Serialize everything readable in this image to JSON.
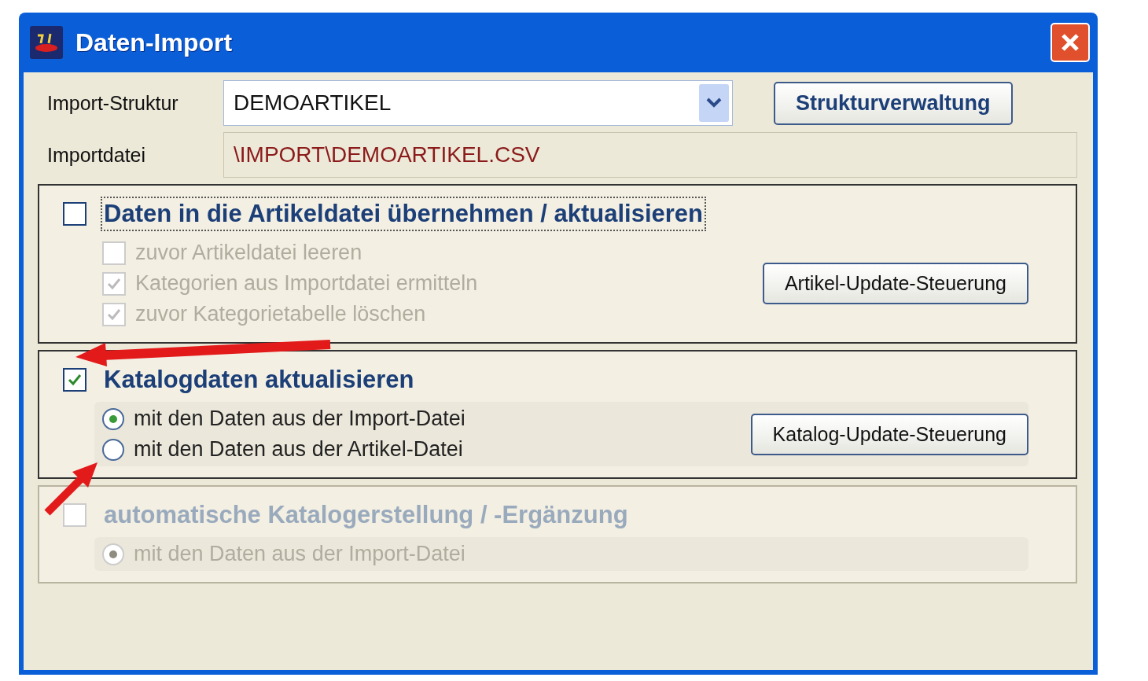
{
  "window": {
    "title": "Daten-Import"
  },
  "fields": [
    {
      "label": "Import-Struktur",
      "kind": "dropdown",
      "value": "DEMOARTIKEL"
    },
    {
      "label": "Importdatei",
      "kind": "readonly",
      "value": "\\IMPORT\\DEMOARTIKEL.CSV"
    }
  ],
  "structure_button": "Strukturverwaltung",
  "groups": [
    {
      "title": "Daten in die Artikeldatei übernehmen / aktualisieren",
      "checked": false,
      "focused": true,
      "disabled": false,
      "button": "Artikel-Update-Steuerung",
      "options": [
        {
          "kind": "checkbox",
          "label": "zuvor Artikeldatei leeren",
          "checked": false,
          "disabled": true
        },
        {
          "kind": "checkbox",
          "label": "Kategorien aus Importdatei ermitteln",
          "checked": true,
          "disabled": true
        },
        {
          "kind": "checkbox",
          "label": "zuvor Kategorietabelle löschen",
          "checked": true,
          "disabled": true
        }
      ]
    },
    {
      "title": "Katalogdaten aktualisieren",
      "checked": true,
      "focused": false,
      "disabled": false,
      "button": "Katalog-Update-Steuerung",
      "options": [
        {
          "kind": "radio",
          "label": "mit den Daten aus der Import-Datei",
          "selected": true,
          "disabled": false
        },
        {
          "kind": "radio",
          "label": "mit den Daten aus der Artikel-Datei",
          "selected": false,
          "disabled": false
        }
      ]
    },
    {
      "title": "automatische Katalogerstellung / -Ergänzung",
      "checked": false,
      "focused": false,
      "disabled": true,
      "options": [
        {
          "kind": "radio",
          "label": "mit den Daten aus der Import-Datei",
          "selected": true,
          "disabled": true
        }
      ]
    }
  ]
}
